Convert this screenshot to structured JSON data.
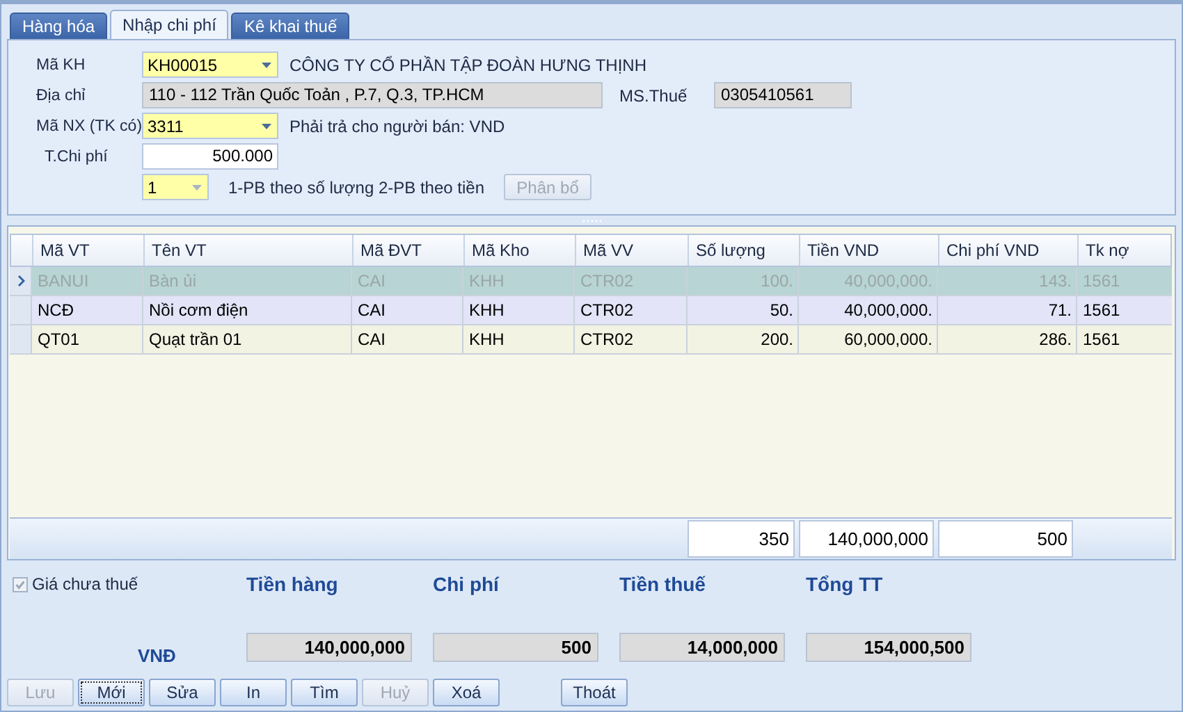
{
  "tabs": [
    {
      "label": "Hàng hóa",
      "selected": false
    },
    {
      "label": "Nhập chi phí",
      "selected": true
    },
    {
      "label": "Kê khai thuế",
      "selected": false
    }
  ],
  "form": {
    "customer_code": {
      "label": "Mã KH",
      "value": "KH00015"
    },
    "customer_name": "CÔNG TY CỔ PHẦN TẬP ĐOÀN HƯNG THỊNH",
    "address": {
      "label": "Địa chỉ",
      "value": "110 - 112 Trần Quốc Toản , P.7, Q.3, TP.HCM"
    },
    "tax_code": {
      "label": "MS.Thuế",
      "value": "0305410561"
    },
    "account": {
      "label": "Mã NX (TK có)",
      "value": "3311"
    },
    "payable_note": "Phải trả cho người bán: VND",
    "cost": {
      "label": "T.Chi phí",
      "value": "500.000"
    },
    "method": {
      "value": "1"
    },
    "method_hint": "1-PB theo số lượng  2-PB theo tiền",
    "allocate_button": {
      "label": "Phân bổ",
      "disabled": true
    }
  },
  "table": {
    "columns": [
      "Mã VT",
      "Tên VT",
      "Mã ĐVT",
      "Mã Kho",
      "Mã VV",
      "Số lượng",
      "Tiền VND",
      "Chi phí VND",
      "Tk nợ"
    ],
    "rows": [
      {
        "selected": true,
        "cells": [
          "BANUI",
          "Bàn ủi",
          "CAI",
          "KHH",
          "CTR02",
          "100.",
          "40,000,000.",
          "143.",
          "1561"
        ]
      },
      {
        "selected": false,
        "cells": [
          "NCĐ",
          "Nồi cơm điện",
          "CAI",
          "KHH",
          "CTR02",
          "50.",
          "40,000,000.",
          "71.",
          "1561"
        ]
      },
      {
        "selected": false,
        "cells": [
          "QT01",
          "Quạt trần 01",
          "CAI",
          "KHH",
          "CTR02",
          "200.",
          "60,000,000.",
          "286.",
          "1561"
        ]
      }
    ],
    "totals": [
      "350",
      "140,000,000",
      "500"
    ]
  },
  "summary": {
    "tax_excluded": {
      "label": "Giá chưa thuế",
      "checked": true,
      "disabled": true
    },
    "currency": "VNĐ",
    "items": [
      {
        "label": "Tiền hàng",
        "value": "140,000,000"
      },
      {
        "label": "Chi phí",
        "value": "500"
      },
      {
        "label": "Tiền thuế",
        "value": "14,000,000"
      },
      {
        "label": "Tổng TT",
        "value": "154,000,500"
      }
    ]
  },
  "buttons": [
    {
      "label": "Lưu",
      "disabled": true,
      "focused": false
    },
    {
      "label": "Mới",
      "disabled": false,
      "focused": true
    },
    {
      "label": "Sửa",
      "disabled": false,
      "focused": false
    },
    {
      "label": "In",
      "disabled": false,
      "focused": false
    },
    {
      "label": "Tìm",
      "disabled": false,
      "focused": false
    },
    {
      "label": "Huỷ",
      "disabled": true,
      "focused": false
    },
    {
      "label": "Xoá",
      "disabled": false,
      "focused": false
    }
  ],
  "exit_button": {
    "label": "Thoát"
  }
}
